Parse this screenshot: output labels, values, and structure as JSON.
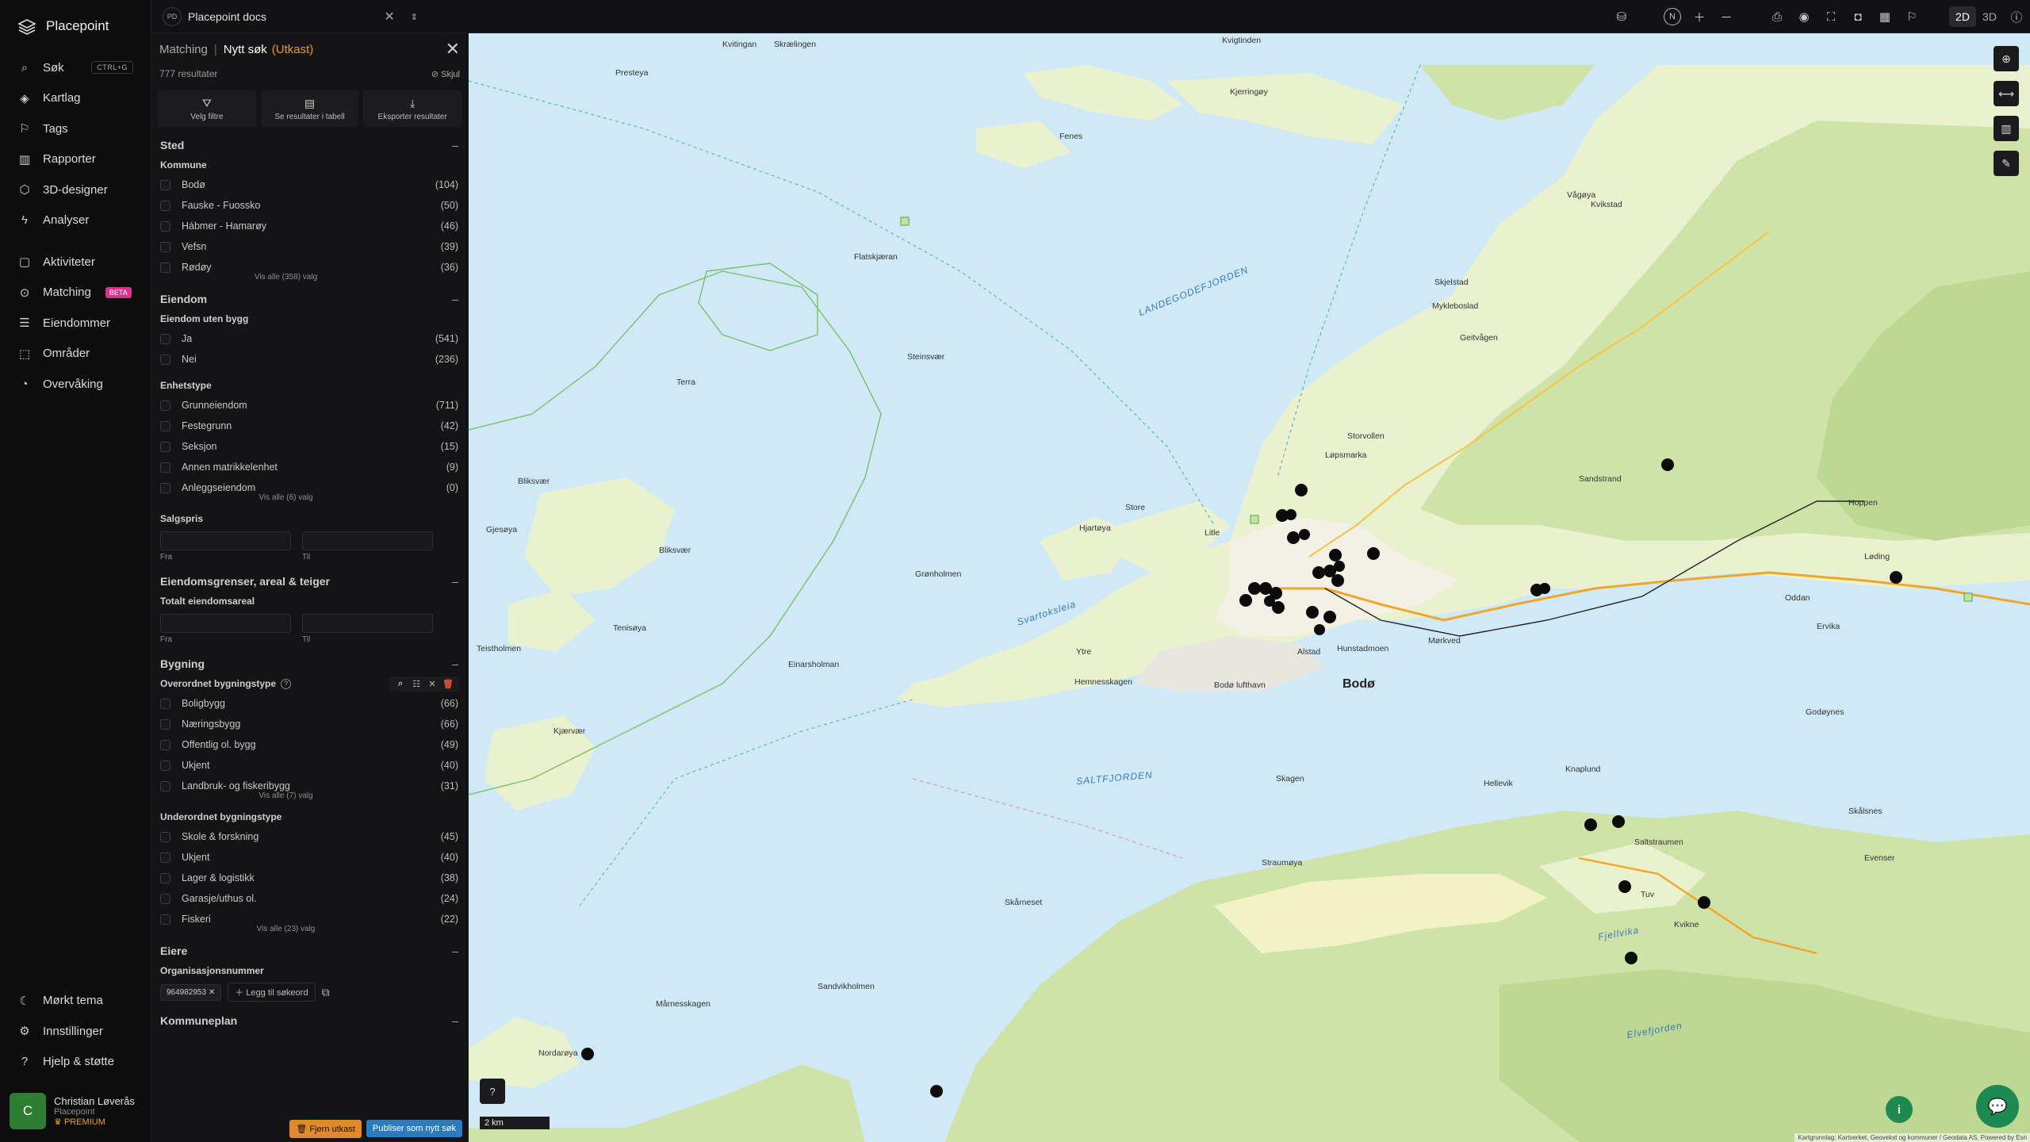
{
  "app": {
    "name": "Placepoint"
  },
  "nav": {
    "items": [
      {
        "label": "Søk",
        "kbd": "CTRL+G",
        "icon": "search-icon"
      },
      {
        "label": "Kartlag",
        "icon": "layers-icon"
      },
      {
        "label": "Tags",
        "icon": "bookmark-icon"
      },
      {
        "label": "Rapporter",
        "icon": "bar-chart-icon"
      },
      {
        "label": "3D-designer",
        "icon": "cube-icon"
      },
      {
        "label": "Analyser",
        "icon": "bolt-icon"
      }
    ],
    "items2": [
      {
        "label": "Aktiviteter",
        "icon": "chat-icon"
      },
      {
        "label": "Matching",
        "badge": "BETA",
        "icon": "match-icon"
      },
      {
        "label": "Eiendommer",
        "icon": "list-icon"
      },
      {
        "label": "Områder",
        "icon": "area-icon"
      },
      {
        "label": "Overvåking",
        "icon": "monitor-icon"
      }
    ],
    "bottom": [
      {
        "label": "Mørkt tema",
        "icon": "moon-icon"
      },
      {
        "label": "Innstillinger",
        "icon": "gear-icon"
      },
      {
        "label": "Hjelp & støtte",
        "icon": "help-icon"
      }
    ]
  },
  "user": {
    "initial": "C",
    "name": "Christian Løverås",
    "org": "Placepoint",
    "plan": "PREMIUM"
  },
  "topbar": {
    "doc_initials": "PD",
    "doc_title": "Placepoint docs",
    "mode_2d": "2D",
    "mode_3d": "3D"
  },
  "panel": {
    "crumb": "Matching",
    "title": "Nytt søk",
    "draft": "(Utkast)",
    "results": "777 resultater",
    "hide": "Skjul",
    "actions": [
      "Velg filtre",
      "Se resultater i tabell",
      "Eksporter resultater"
    ],
    "sted": {
      "title": "Sted",
      "kommune_title": "Kommune",
      "kommune": [
        {
          "label": "Bodø",
          "count": "(104)"
        },
        {
          "label": "Fauske - Fuossko",
          "count": "(50)"
        },
        {
          "label": "Hábmer - Hamarøy",
          "count": "(46)"
        },
        {
          "label": "Vefsn",
          "count": "(39)"
        },
        {
          "label": "Rødøy",
          "count": "(36)"
        }
      ],
      "more": "Vis alle (358) valg"
    },
    "eiendom": {
      "title": "Eiendom",
      "uten_title": "Eiendom uten bygg",
      "uten": [
        {
          "label": "Ja",
          "count": "(541)"
        },
        {
          "label": "Nei",
          "count": "(236)"
        }
      ],
      "enhet_title": "Enhetstype",
      "enhet": [
        {
          "label": "Grunneiendom",
          "count": "(711)"
        },
        {
          "label": "Festegrunn",
          "count": "(42)"
        },
        {
          "label": "Seksjon",
          "count": "(15)"
        },
        {
          "label": "Annen matrikkelenhet",
          "count": "(9)"
        },
        {
          "label": "Anleggseiendom",
          "count": "(0)"
        }
      ],
      "enhet_more": "Vis alle (6) valg",
      "salg_title": "Salgspris",
      "from": "Fra",
      "to": "Til"
    },
    "grenser": {
      "title": "Eiendomsgrenser, areal & teiger",
      "areal_title": "Totalt eiendomsareal",
      "from": "Fra",
      "to": "Til"
    },
    "bygning": {
      "title": "Bygning",
      "over_title": "Overordnet bygningstype",
      "over": [
        {
          "label": "Boligbygg",
          "count": "(66)"
        },
        {
          "label": "Næringsbygg",
          "count": "(66)"
        },
        {
          "label": "Offentlig ol. bygg",
          "count": "(49)"
        },
        {
          "label": "Ukjent",
          "count": "(40)"
        },
        {
          "label": "Landbruk- og fiskeribygg",
          "count": "(31)"
        }
      ],
      "over_more": "Vis alle (7) valg",
      "under_title": "Underordnet bygningstype",
      "under": [
        {
          "label": "Skole & forskning",
          "count": "(45)"
        },
        {
          "label": "Ukjent",
          "count": "(40)"
        },
        {
          "label": "Lager & logistikk",
          "count": "(38)"
        },
        {
          "label": "Garasje/uthus ol.",
          "count": "(24)"
        },
        {
          "label": "Fiskeri",
          "count": "(22)"
        }
      ],
      "under_more": "Vis alle (23) valg"
    },
    "eiere": {
      "title": "Eiere",
      "org_title": "Organisasjonsnummer",
      "chip": "964982953",
      "add": "Legg til søkeord"
    },
    "kommuneplan": {
      "title": "Kommuneplan"
    },
    "remove_draft": "Fjern utkast",
    "publish": "Publiser som nytt søk"
  },
  "map": {
    "scale": "2 km",
    "attribution": "Kartgrunnlag: Kartverket, Geovekst og kommuner / Geodata AS. Powered by Esri",
    "city": "Bodø",
    "labels": [
      {
        "t": "Kvitingan",
        "w": false
      },
      {
        "t": "Presteya",
        "w": false
      },
      {
        "t": "Skrælingen",
        "w": false
      },
      {
        "t": "Fenes",
        "w": false
      },
      {
        "t": "Kvigtinden",
        "w": false
      },
      {
        "t": "Kjerringøy",
        "w": false
      },
      {
        "t": "Flatskjæran",
        "w": false
      },
      {
        "t": "LANDEGODEFJORDEN",
        "w": true
      },
      {
        "t": "Steinsvær",
        "w": false
      },
      {
        "t": "Terra",
        "w": false
      },
      {
        "t": "Bliksvær",
        "w": false
      },
      {
        "t": "Gjesøya",
        "w": false
      },
      {
        "t": "Bliksvær",
        "w": false
      },
      {
        "t": "Grønholmen",
        "w": false
      },
      {
        "t": "Tenisøya",
        "w": false
      },
      {
        "t": "Einarsholman",
        "w": false
      },
      {
        "t": "Teistholmen",
        "w": false
      },
      {
        "t": "Kjærvær",
        "w": false
      },
      {
        "t": "SALTFJORDEN",
        "w": true
      },
      {
        "t": "Svartoksleia",
        "w": true
      },
      {
        "t": "Bodø lufthavn",
        "w": false
      },
      {
        "t": "Hunstadmoen",
        "w": false
      },
      {
        "t": "Mørkved",
        "w": false
      },
      {
        "t": "Løding",
        "w": false
      },
      {
        "t": "Skagen",
        "w": false
      },
      {
        "t": "Straumøya",
        "w": false
      },
      {
        "t": "Saltstraumen",
        "w": false
      },
      {
        "t": "Nordarøya",
        "w": false
      },
      {
        "t": "Mårnesskagen",
        "w": false
      },
      {
        "t": "Sandvikholmen",
        "w": false
      },
      {
        "t": "Skårneset",
        "w": false
      },
      {
        "t": "Geitvågen",
        "w": false
      },
      {
        "t": "Mykleboslad",
        "w": false
      },
      {
        "t": "Skjelstad",
        "w": false
      },
      {
        "t": "Vågøya",
        "w": false
      },
      {
        "t": "Kvikstad",
        "w": false
      },
      {
        "t": "Storvollen",
        "w": false
      },
      {
        "t": "Løpsmarka",
        "w": false
      },
      {
        "t": "Hjartøya",
        "w": false
      },
      {
        "t": "Store",
        "w": false
      },
      {
        "t": "Litle",
        "w": false
      },
      {
        "t": "Alstad",
        "w": false
      },
      {
        "t": "Hemnesskagen",
        "w": false
      },
      {
        "t": "Ytre",
        "w": false
      },
      {
        "t": "Godøynes",
        "w": false
      },
      {
        "t": "Hellevik",
        "w": false
      },
      {
        "t": "Knaplund",
        "w": false
      },
      {
        "t": "Skålsnes",
        "w": false
      },
      {
        "t": "Evenser",
        "w": false
      },
      {
        "t": "Fjellvika",
        "w": true
      },
      {
        "t": "Elvefjorden",
        "w": true
      },
      {
        "t": "Tuv",
        "w": false
      },
      {
        "t": "Kvikne",
        "w": false
      },
      {
        "t": "Hoppen",
        "w": false
      },
      {
        "t": "Sandstrand",
        "w": false
      },
      {
        "t": "Oddan",
        "w": false
      },
      {
        "t": "Ervika",
        "w": false
      }
    ]
  }
}
